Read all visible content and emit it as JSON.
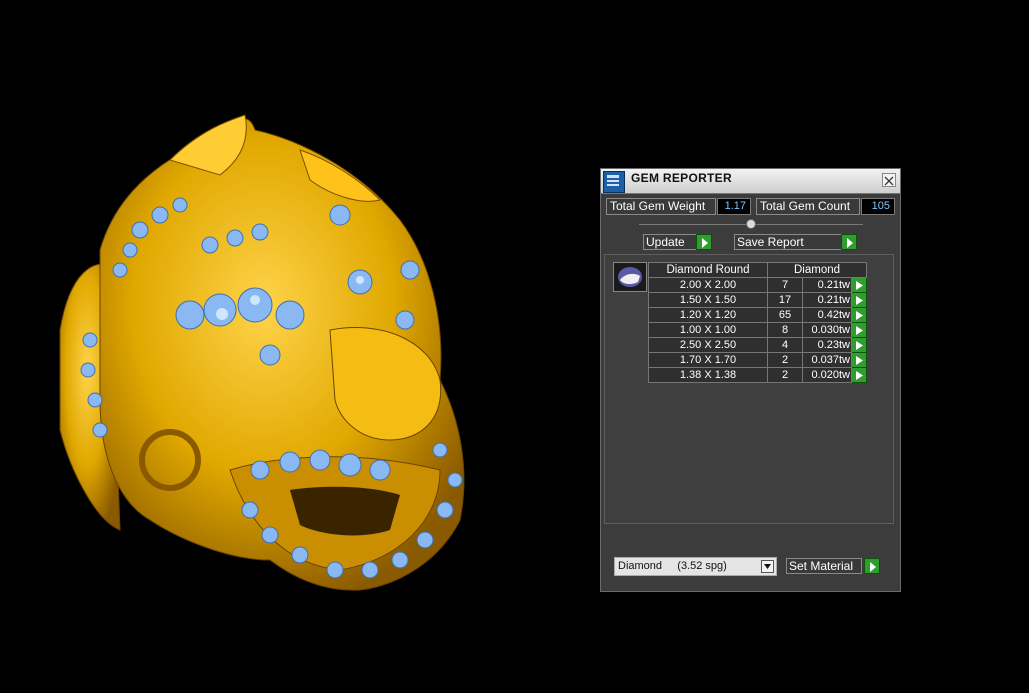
{
  "viewport": {
    "colors": {
      "gold": "#e0a800",
      "gold_light": "#ffd34a",
      "gem": "#8ab8f2",
      "gem_light": "#cfe6ff"
    }
  },
  "panel": {
    "title": "GEM REPORTER",
    "app_icon": "gem-reporter-app-icon",
    "close_icon": "close-icon",
    "totals": {
      "weight_label": "Total Gem Weight",
      "weight_value": "1.17",
      "count_label": "Total Gem Count",
      "count_value": "105"
    },
    "buttons": {
      "update_label": "Update",
      "save_label": "Save Report",
      "set_material_label": "Set Material"
    },
    "table": {
      "headers": [
        "Diamond Round",
        "Diamond"
      ],
      "rows": [
        {
          "size": "2.00 X 2.00",
          "count": "7",
          "weight": "0.21tw"
        },
        {
          "size": "1.50 X 1.50",
          "count": "17",
          "weight": "0.21tw"
        },
        {
          "size": "1.20 X 1.20",
          "count": "65",
          "weight": "0.42tw"
        },
        {
          "size": "1.00 X 1.00",
          "count": "8",
          "weight": "0.030tw"
        },
        {
          "size": "2.50 X 2.50",
          "count": "4",
          "weight": "0.23tw"
        },
        {
          "size": "1.70 X 1.70",
          "count": "2",
          "weight": "0.037tw"
        },
        {
          "size": "1.38 X 1.38",
          "count": "2",
          "weight": "0.020tw"
        }
      ]
    },
    "material": {
      "selected": "Diamond     (3.52 spg)"
    },
    "colors": {
      "accent_green": "#2f9e2f",
      "value_blue": "#7ec8ff"
    }
  }
}
